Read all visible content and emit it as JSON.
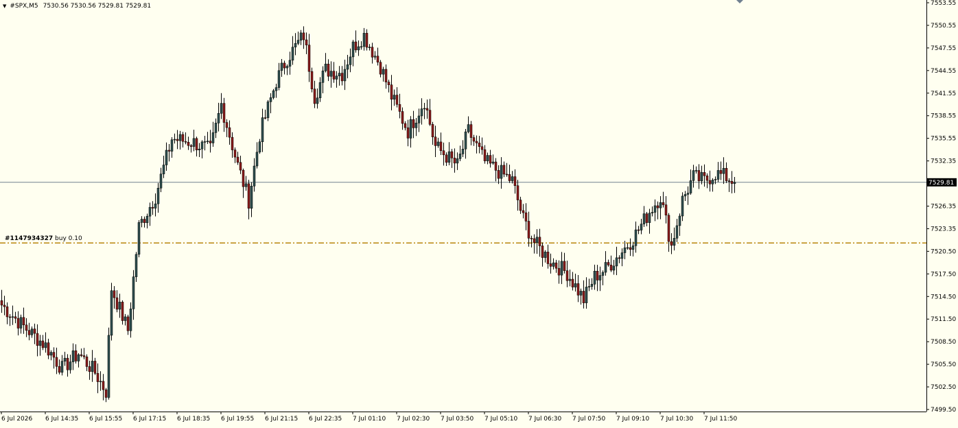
{
  "header": {
    "symbol": "#SPX,M5",
    "ohlc": "7530.56 7530.56 7529.81 7529.81",
    "dropdown_icon": "triangle-down-icon"
  },
  "order_line": {
    "ticket": "#1147934327",
    "label": "buy 0.10",
    "price": 7521.9,
    "color": "#b8860b"
  },
  "current_price": {
    "value": 7529.81,
    "label": "7529.81",
    "line_color": "#708090"
  },
  "colors": {
    "background": "#fffff0",
    "bull_body": "#2f4f4f",
    "bear_body": "#8b1a1a",
    "wick": "#000000",
    "price_tag_bg": "#000000"
  },
  "chart_data": {
    "type": "candlestick",
    "ylim": [
      7499.9,
      7553.6
    ],
    "y_ticks": [
      "7553.55",
      "7550.55",
      "7547.55",
      "7544.55",
      "7541.55",
      "7538.55",
      "7535.55",
      "7532.35",
      "7529.35",
      "7526.35",
      "7523.35",
      "7520.50",
      "7517.50",
      "7514.50",
      "7511.50",
      "7508.50",
      "7505.50",
      "7502.50",
      "7499.50"
    ],
    "x_ticks": [
      "6 Jul 2026",
      "6 Jul 14:35",
      "6 Jul 15:55",
      "6 Jul 17:15",
      "6 Jul 18:35",
      "6 Jul 19:55",
      "6 Jul 21:15",
      "6 Jul 22:35",
      "7 Jul 01:10",
      "7 Jul 02:30",
      "7 Jul 03:50",
      "7 Jul 05:10",
      "7 Jul 06:30",
      "7 Jul 07:50",
      "7 Jul 09:10",
      "7 Jul 10:30",
      "7 Jul 11:50"
    ],
    "x_tick_bars": [
      0,
      16,
      32,
      48,
      64,
      80,
      96,
      112,
      128,
      144,
      160,
      176,
      192,
      208,
      224,
      240,
      256
    ],
    "close_path": [
      [
        0,
        7513.8
      ],
      [
        8,
        7511.0
      ],
      [
        16,
        7508.5
      ],
      [
        22,
        7505.5
      ],
      [
        28,
        7507.5
      ],
      [
        34,
        7505.0
      ],
      [
        38,
        7502.5
      ],
      [
        40,
        7516.0
      ],
      [
        46,
        7510.5
      ],
      [
        50,
        7524.0
      ],
      [
        56,
        7528.0
      ],
      [
        62,
        7535.5
      ],
      [
        70,
        7535.0
      ],
      [
        76,
        7534.0
      ],
      [
        80,
        7540.0
      ],
      [
        86,
        7532.0
      ],
      [
        90,
        7527.5
      ],
      [
        94,
        7536.0
      ],
      [
        100,
        7543.0
      ],
      [
        104,
        7546.0
      ],
      [
        110,
        7549.0
      ],
      [
        114,
        7541.0
      ],
      [
        118,
        7544.5
      ],
      [
        124,
        7544.0
      ],
      [
        128,
        7547.5
      ],
      [
        132,
        7549.0
      ],
      [
        138,
        7545.0
      ],
      [
        142,
        7541.0
      ],
      [
        148,
        7536.5
      ],
      [
        154,
        7540.5
      ],
      [
        158,
        7534.5
      ],
      [
        166,
        7532.0
      ],
      [
        170,
        7536.5
      ],
      [
        176,
        7532.5
      ],
      [
        182,
        7531.0
      ],
      [
        186,
        7530.0
      ],
      [
        190,
        7525.0
      ],
      [
        194,
        7522.0
      ],
      [
        200,
        7519.5
      ],
      [
        206,
        7518.0
      ],
      [
        212,
        7514.5
      ],
      [
        216,
        7517.5
      ],
      [
        220,
        7518.5
      ],
      [
        224,
        7520.0
      ],
      [
        230,
        7522.5
      ],
      [
        236,
        7526.0
      ],
      [
        240,
        7528.0
      ],
      [
        244,
        7521.5
      ],
      [
        248,
        7527.5
      ],
      [
        252,
        7530.5
      ],
      [
        256,
        7530.0
      ],
      [
        260,
        7531.0
      ],
      [
        264,
        7530.5
      ],
      [
        267,
        7529.81
      ]
    ]
  }
}
